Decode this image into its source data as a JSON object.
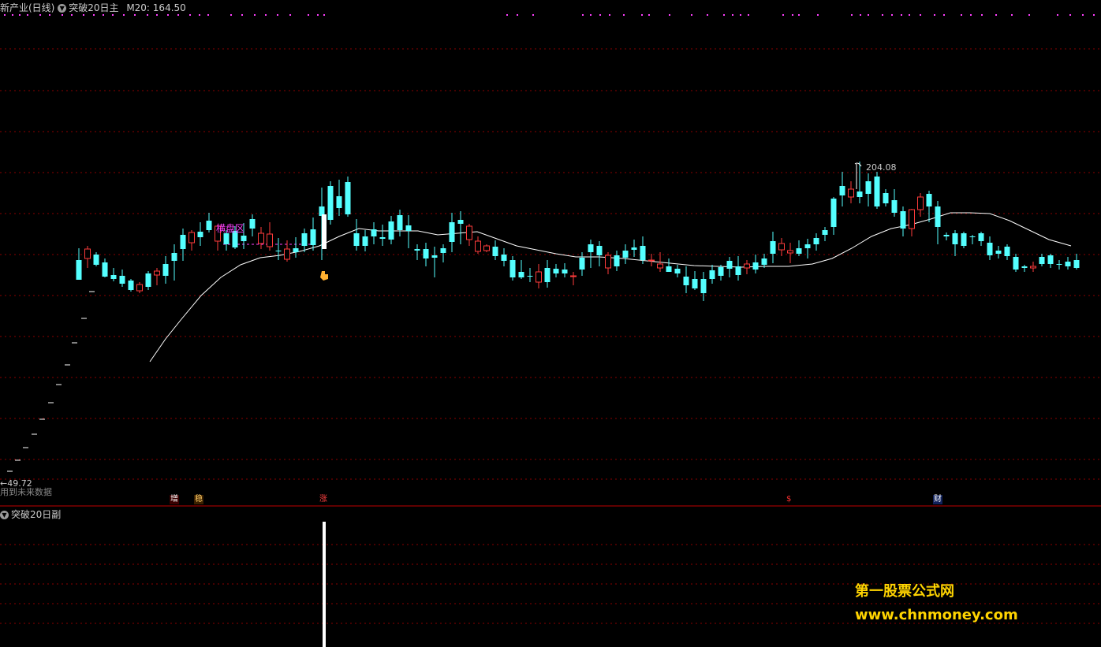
{
  "main_panel": {
    "title": "新产业(日线)",
    "indicator": "突破20日主",
    "ma_label": "M20: 164.50",
    "label_box": "横盘区",
    "high_label": "204.08",
    "low_label": "←49.72",
    "future_note": "用到未来数据",
    "markers": [
      "增",
      "稳",
      "涨",
      "$",
      "财"
    ]
  },
  "sub_panel": {
    "indicator": "突破20日副"
  },
  "watermark": {
    "line1": "第一股票公式网",
    "line2": "www.chnmoney.com"
  },
  "colors": {
    "up": "#ff3c3c",
    "down": "#54ffff",
    "ma": "#ffffff",
    "grid": "#8b0000",
    "label": "#ff40ff",
    "watermark": "#ffd400"
  },
  "chart_data": {
    "type": "candlestick",
    "ma_name": "M20",
    "ma_value": 164.5,
    "price_high": 204.08,
    "price_low": 49.72,
    "candles": [
      [
        100,
        315,
        352,
        330,
        355
      ],
      [
        111,
        312,
        340,
        328,
        316
      ],
      [
        122,
        320,
        338,
        323,
        336
      ],
      [
        133,
        328,
        352,
        333,
        351
      ],
      [
        144,
        340,
        357,
        349,
        354
      ],
      [
        155,
        342,
        364,
        350,
        360
      ],
      [
        166,
        354,
        370,
        356,
        368
      ],
      [
        177,
        358,
        372,
        369,
        361
      ],
      [
        188,
        344,
        368,
        347,
        364
      ],
      [
        199,
        340,
        362,
        349,
        344
      ],
      [
        210,
        325,
        360,
        335,
        350
      ],
      [
        221,
        310,
        356,
        321,
        331
      ],
      [
        232,
        290,
        331,
        298,
        316
      ],
      [
        243,
        292,
        318,
        308,
        295
      ],
      [
        254,
        282,
        312,
        294,
        301
      ],
      [
        265,
        270,
        295,
        280,
        292
      ],
      [
        276,
        285,
        318,
        306,
        287
      ],
      [
        287,
        292,
        318,
        296,
        310
      ],
      [
        298,
        287,
        316,
        293,
        314
      ],
      [
        309,
        283,
        316,
        299,
        306
      ],
      [
        320,
        272,
        300,
        278,
        290
      ],
      [
        331,
        288,
        316,
        309,
        296
      ],
      [
        342,
        282,
        318,
        313,
        297
      ],
      [
        353,
        302,
        330,
        318,
        319
      ],
      [
        364,
        305,
        332,
        329,
        316
      ],
      [
        375,
        301,
        327,
        315,
        320
      ],
      [
        386,
        290,
        320,
        296,
        312
      ],
      [
        397,
        276,
        318,
        291,
        311
      ],
      [
        408,
        238,
        330,
        262,
        274
      ],
      [
        419,
        230,
        285,
        236,
        279
      ],
      [
        430,
        228,
        274,
        249,
        264
      ],
      [
        441,
        224,
        275,
        231,
        272
      ],
      [
        452,
        278,
        318,
        296,
        312
      ],
      [
        463,
        292,
        319,
        300,
        312
      ],
      [
        474,
        282,
        310,
        291,
        300
      ],
      [
        485,
        285,
        312,
        301,
        303
      ],
      [
        496,
        274,
        310,
        281,
        304
      ],
      [
        507,
        266,
        300,
        273,
        292
      ],
      [
        518,
        273,
        315,
        286,
        293
      ],
      [
        529,
        310,
        330,
        316,
        318
      ],
      [
        540,
        308,
        338,
        316,
        328
      ],
      [
        551,
        313,
        352,
        324,
        327
      ],
      [
        562,
        310,
        333,
        315,
        321
      ],
      [
        573,
        270,
        320,
        282,
        307
      ],
      [
        584,
        268,
        310,
        279,
        284
      ],
      [
        595,
        284,
        312,
        304,
        287
      ],
      [
        606,
        300,
        322,
        319,
        306
      ],
      [
        617,
        310,
        320,
        318,
        312
      ],
      [
        628,
        305,
        330,
        313,
        325
      ],
      [
        639,
        315,
        338,
        323,
        331
      ],
      [
        650,
        325,
        356,
        330,
        352
      ],
      [
        661,
        330,
        354,
        345,
        352
      ],
      [
        672,
        340,
        358,
        350,
        350
      ],
      [
        683,
        335,
        366,
        358,
        345
      ],
      [
        694,
        330,
        365,
        340,
        358
      ],
      [
        705,
        335,
        352,
        341,
        347
      ],
      [
        716,
        334,
        352,
        342,
        347
      ],
      [
        727,
        345,
        362,
        351,
        350
      ],
      [
        738,
        320,
        350,
        327,
        342
      ],
      [
        749,
        304,
        340,
        310,
        320
      ],
      [
        760,
        306,
        338,
        312,
        324
      ],
      [
        771,
        320,
        348,
        340,
        324
      ],
      [
        782,
        318,
        344,
        324,
        338
      ],
      [
        793,
        310,
        335,
        318,
        327
      ],
      [
        804,
        304,
        326,
        314,
        317
      ],
      [
        815,
        300,
        335,
        312,
        330
      ],
      [
        826,
        322,
        338,
        331,
        330
      ],
      [
        837,
        320,
        345,
        340,
        335
      ],
      [
        848,
        328,
        345,
        338,
        345
      ],
      [
        859,
        336,
        352,
        341,
        347
      ],
      [
        870,
        338,
        372,
        351,
        362
      ],
      [
        881,
        344,
        368,
        354,
        366
      ],
      [
        892,
        345,
        382,
        354,
        372
      ],
      [
        903,
        336,
        360,
        343,
        354
      ],
      [
        914,
        336,
        356,
        339,
        350
      ],
      [
        925,
        326,
        352,
        331,
        341
      ],
      [
        936,
        325,
        356,
        338,
        349
      ],
      [
        947,
        330,
        348,
        340,
        335
      ],
      [
        958,
        323,
        347,
        333,
        342
      ],
      [
        969,
        322,
        340,
        328,
        336
      ],
      [
        980,
        294,
        334,
        306,
        322
      ],
      [
        991,
        302,
        325,
        317,
        309
      ],
      [
        1002,
        308,
        334,
        321,
        318
      ],
      [
        1013,
        305,
        325,
        315,
        322
      ],
      [
        1024,
        303,
        328,
        310,
        315
      ],
      [
        1035,
        296,
        318,
        302,
        310
      ],
      [
        1046,
        288,
        306,
        292,
        298
      ],
      [
        1057,
        250,
        298,
        252,
        288
      ],
      [
        1068,
        218,
        262,
        236,
        248
      ],
      [
        1079,
        230,
        258,
        250,
        240
      ],
      [
        1090,
        205,
        258,
        243,
        250
      ],
      [
        1101,
        220,
        262,
        230,
        246
      ],
      [
        1112,
        218,
        265,
        224,
        262
      ],
      [
        1123,
        240,
        262,
        245,
        258
      ],
      [
        1134,
        240,
        275,
        254,
        270
      ],
      [
        1145,
        262,
        300,
        268,
        290
      ],
      [
        1156,
        265,
        300,
        290,
        266
      ],
      [
        1167,
        245,
        275,
        266,
        250
      ],
      [
        1178,
        242,
        282,
        246,
        262
      ],
      [
        1189,
        255,
        310,
        262,
        288
      ],
      [
        1200,
        295,
        305,
        298,
        300
      ],
      [
        1211,
        292,
        325,
        296,
        310
      ],
      [
        1222,
        294,
        315,
        296,
        312
      ],
      [
        1233,
        298,
        310,
        300,
        300
      ],
      [
        1244,
        294,
        312,
        296,
        306
      ],
      [
        1255,
        300,
        330,
        308,
        324
      ],
      [
        1266,
        312,
        328,
        318,
        322
      ],
      [
        1277,
        310,
        330,
        313,
        325
      ],
      [
        1288,
        322,
        345,
        326,
        342
      ],
      [
        1299,
        336,
        345,
        338,
        340
      ],
      [
        1310,
        332,
        345,
        340,
        338
      ],
      [
        1321,
        322,
        338,
        326,
        335
      ],
      [
        1332,
        322,
        340,
        324,
        335
      ],
      [
        1343,
        330,
        342,
        335,
        336
      ],
      [
        1354,
        326,
        342,
        332,
        338
      ],
      [
        1365,
        322,
        342,
        330,
        340
      ]
    ]
  }
}
